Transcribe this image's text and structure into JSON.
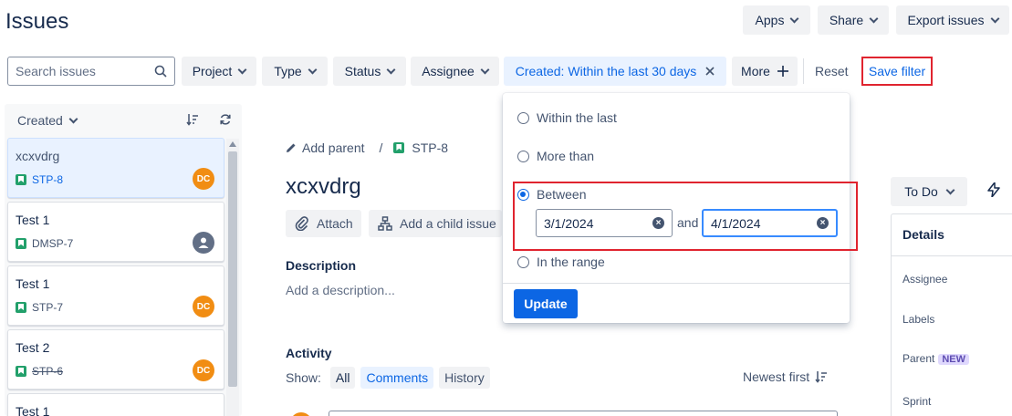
{
  "header": {
    "title": "Issues",
    "apps_label": "Apps",
    "share_label": "Share",
    "export_label": "Export issues"
  },
  "filters": {
    "search_placeholder": "Search issues",
    "project_label": "Project",
    "type_label": "Type",
    "status_label": "Status",
    "assignee_label": "Assignee",
    "created_label": "Created:",
    "created_value": "Within the last 30 days",
    "more_label": "More",
    "reset_label": "Reset",
    "save_filter_label": "Save filter"
  },
  "list": {
    "sort_label": "Created",
    "items": [
      {
        "title": "xcxvdrg",
        "key": "STP-8",
        "avatar": "DC",
        "selected": true
      },
      {
        "title": "Test 1",
        "key": "DMSP-7",
        "avatar": "",
        "selected": false
      },
      {
        "title": "Test 1",
        "key": "STP-7",
        "avatar": "DC",
        "selected": false
      },
      {
        "title": "Test 2",
        "key": "STP-6",
        "avatar": "DC",
        "selected": false,
        "done": true
      },
      {
        "title": "Test 1",
        "key": "",
        "avatar": "",
        "selected": false
      }
    ]
  },
  "issue": {
    "add_parent_label": "Add parent",
    "breadcrumb_sep": "/",
    "key": "STP-8",
    "title": "xcxvdrg",
    "attach_label": "Attach",
    "add_child_label": "Add a child issue",
    "description_label": "Description",
    "description_placeholder": "Add a description...",
    "activity_label": "Activity",
    "show_label": "Show:",
    "show_all": "All",
    "show_comments": "Comments",
    "show_history": "History",
    "newest_first_label": "Newest first"
  },
  "sidebar": {
    "status_label": "To Do",
    "details_label": "Details",
    "fields": {
      "assignee": "Assignee",
      "labels": "Labels",
      "parent": "Parent",
      "parent_badge": "NEW",
      "sprint": "Sprint"
    }
  },
  "date_popup": {
    "option_within": "Within the last",
    "option_more_than": "More than",
    "option_between": "Between",
    "option_range": "In the range",
    "selected_option": "Between",
    "from_date": "3/1/2024",
    "and_label": "and",
    "to_date": "4/1/2024",
    "update_label": "Update"
  },
  "colors": {
    "accent": "#0c66e4",
    "highlight_box": "#e0242f",
    "avatar": "#f18d13",
    "story_icon": "#22a06b"
  }
}
